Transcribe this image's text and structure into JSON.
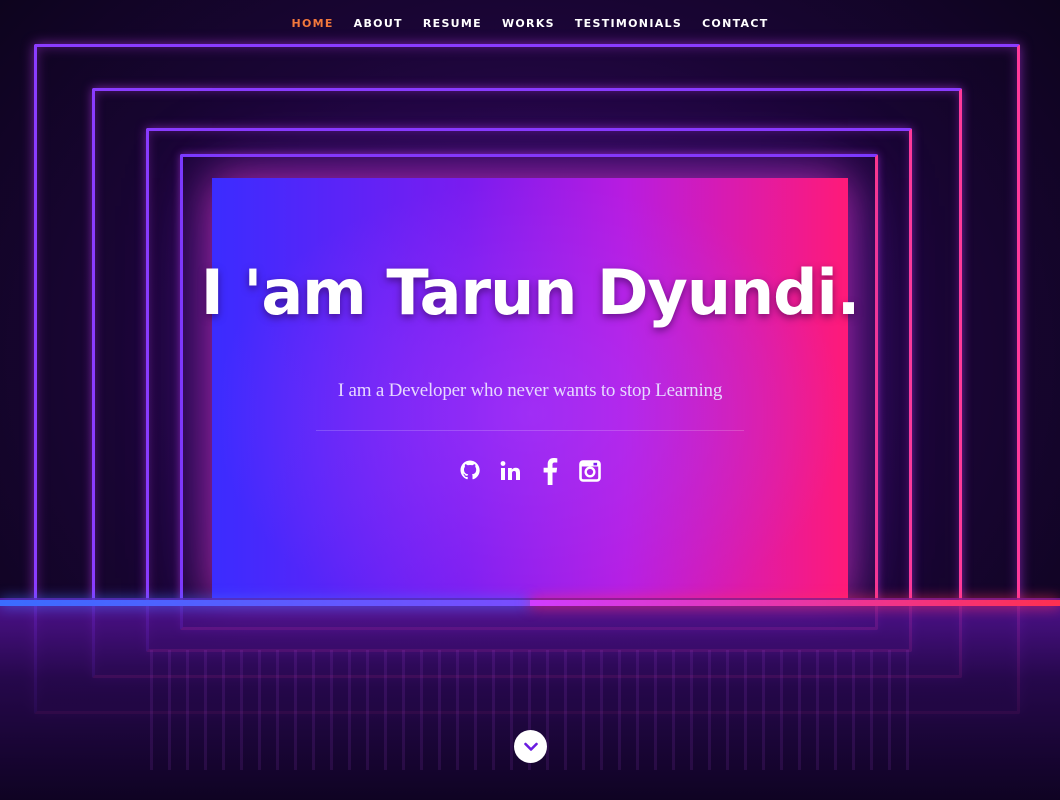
{
  "nav": {
    "items": [
      {
        "label": "HOME",
        "active": true
      },
      {
        "label": "ABOUT",
        "active": false
      },
      {
        "label": "RESUME",
        "active": false
      },
      {
        "label": "WORKS",
        "active": false
      },
      {
        "label": "TESTIMONIALS",
        "active": false
      },
      {
        "label": "CONTACT",
        "active": false
      }
    ],
    "active_color": "#f2783c"
  },
  "hero": {
    "title": "I 'am Tarun Dyundi.",
    "subtitle": "I am a Developer who never wants to stop Learning"
  },
  "social": {
    "icons": [
      "github-icon",
      "linkedin-icon",
      "facebook-icon",
      "instagram-icon"
    ]
  },
  "scroll": {
    "icon": "chevron-down-icon"
  },
  "colors": {
    "panel_left": "#3b2cff",
    "panel_right": "#ff1a78",
    "text": "#ffffff"
  }
}
